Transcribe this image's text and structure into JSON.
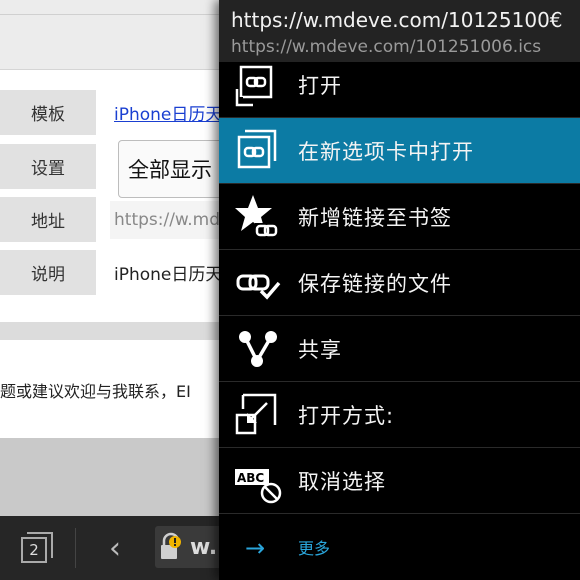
{
  "page": {
    "rows": [
      {
        "label": "模板",
        "value": "iPhone日历天"
      },
      {
        "label": "设置",
        "value": "全部显示"
      },
      {
        "label": "地址",
        "value": "https://w.mde"
      },
      {
        "label": "说明",
        "value": "iPhone日历天"
      }
    ],
    "notice": "题或建议欢迎与我联系，EI"
  },
  "toolbar": {
    "tab_count": "2",
    "back_glyph": "‹",
    "address_text": "w.r"
  },
  "menu": {
    "title": "https://w.mdeve.com/10125100€",
    "subtitle": "https://w.mdeve.com/101251006.ics",
    "items": [
      {
        "label": "打开",
        "icon": "open-link-icon",
        "active": false
      },
      {
        "label": "在新选项卡中打开",
        "icon": "open-new-tab-icon",
        "active": true
      },
      {
        "label": "新增链接至书签",
        "icon": "bookmark-star-icon",
        "active": false
      },
      {
        "label": "保存链接的文件",
        "icon": "save-link-icon",
        "active": false
      },
      {
        "label": "共享",
        "icon": "share-icon",
        "active": false
      },
      {
        "label": "打开方式:",
        "icon": "open-with-icon",
        "active": false
      },
      {
        "label": "取消选择",
        "icon": "cancel-selection-icon",
        "active": false
      }
    ],
    "more_label": "更多",
    "more_glyph": "→",
    "abc_text": "ABC"
  },
  "colors": {
    "menu_bg": "#000000",
    "menu_active": "#0c7ba4",
    "accent": "#2aa6dc",
    "link": "#1a3fd1"
  }
}
